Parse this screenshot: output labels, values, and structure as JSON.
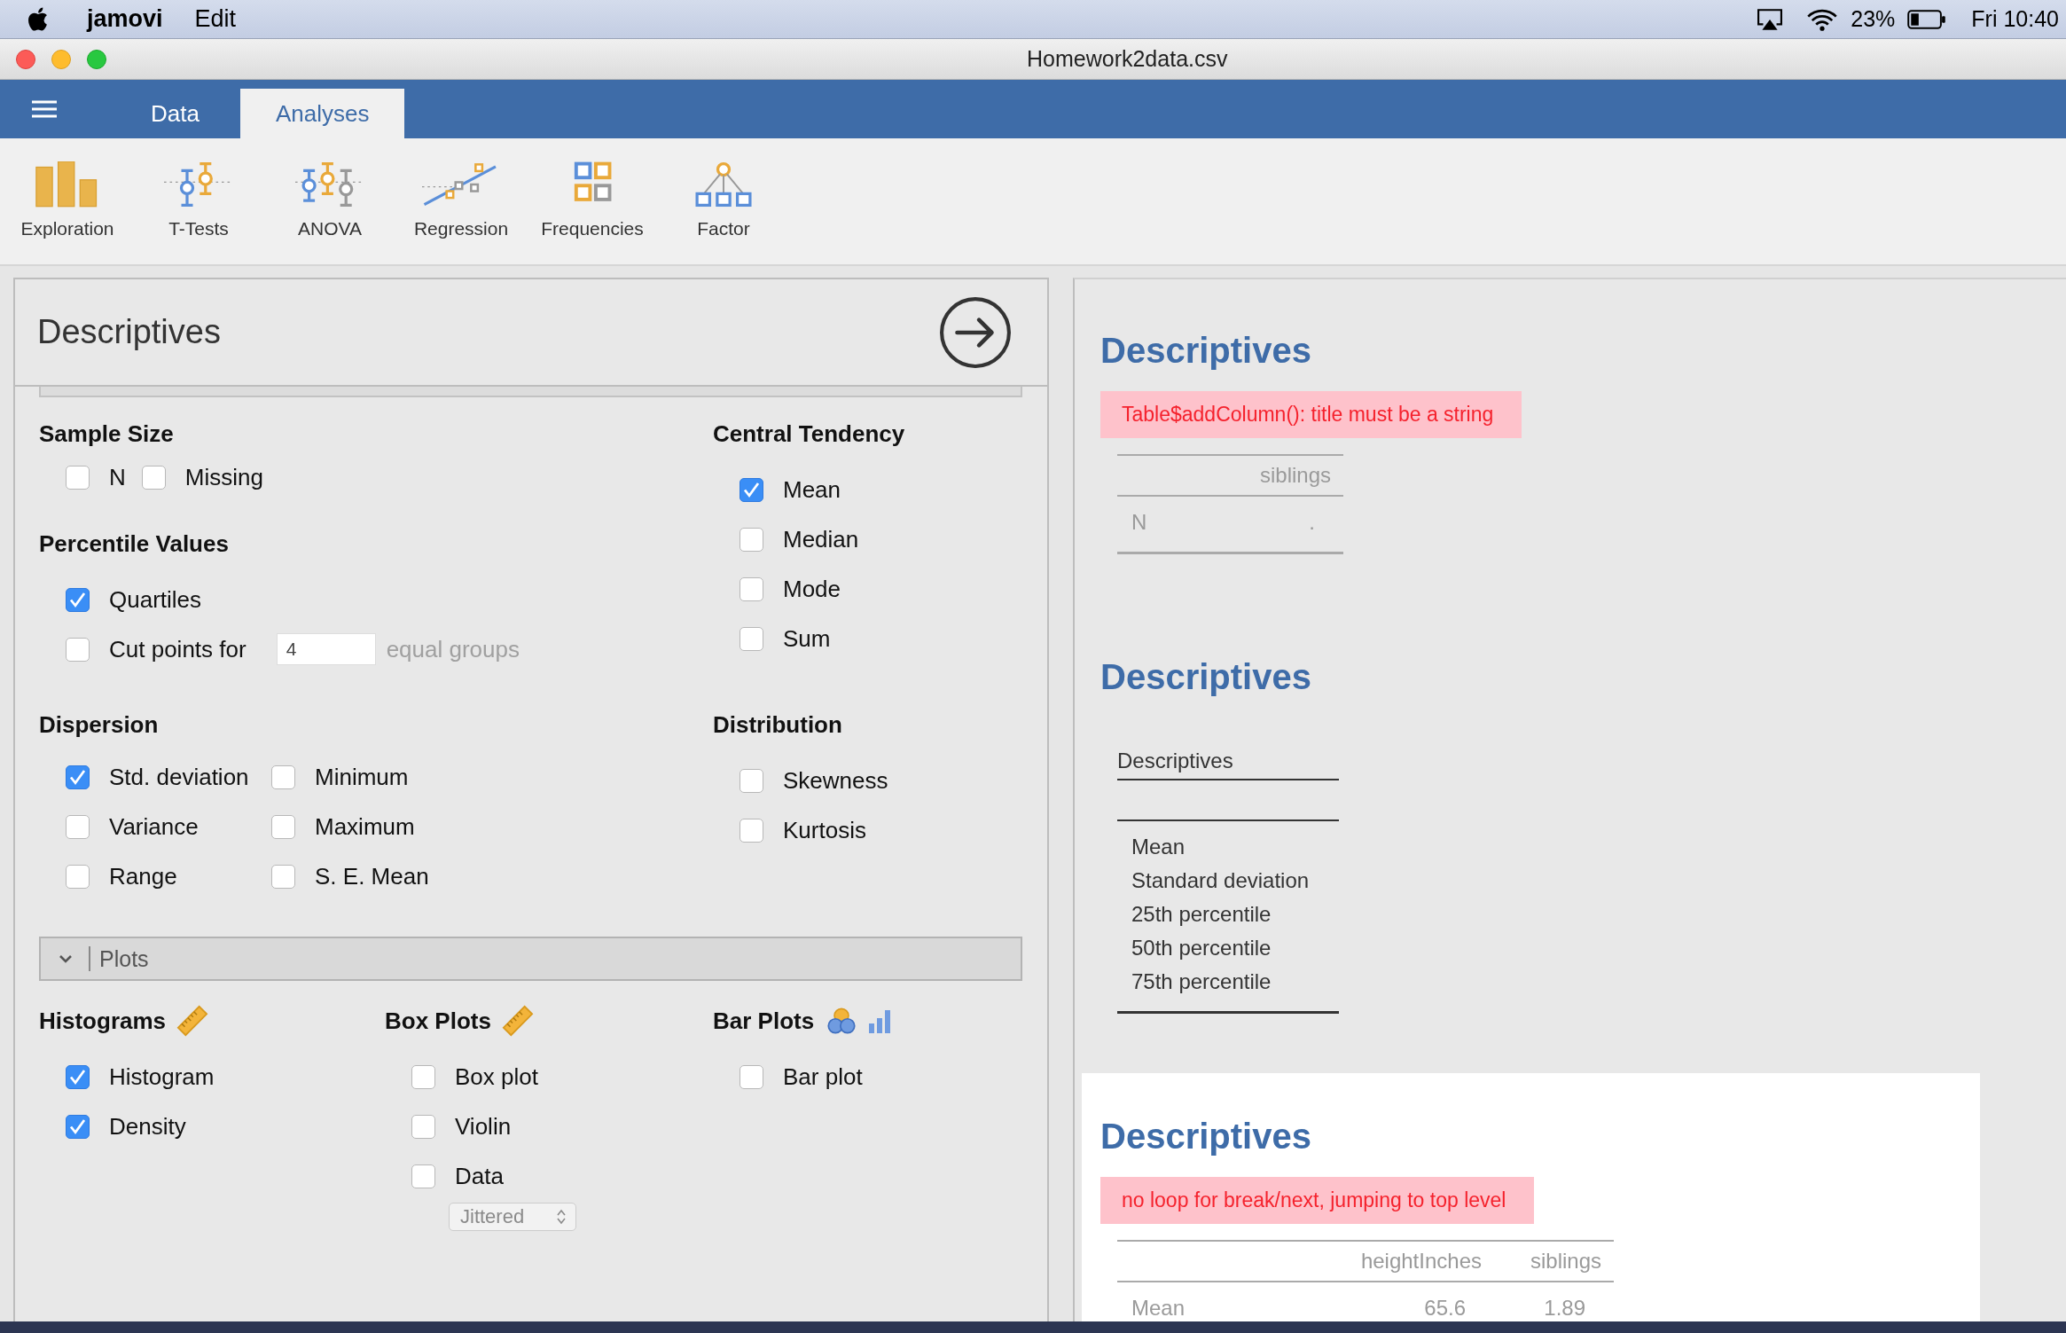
{
  "menubar": {
    "app": "jamovi",
    "menus": [
      "Edit"
    ],
    "battery": "23%",
    "clock": "Fri 10:40"
  },
  "window": {
    "title": "Homework2data.csv"
  },
  "tabs": [
    {
      "label": "Data",
      "selected": false
    },
    {
      "label": "Analyses",
      "selected": true
    }
  ],
  "ribbon": [
    {
      "label": "Exploration",
      "kind": "exploration"
    },
    {
      "label": "T-Tests",
      "kind": "ttests"
    },
    {
      "label": "ANOVA",
      "kind": "anova"
    },
    {
      "label": "Regression",
      "kind": "regression"
    },
    {
      "label": "Frequencies",
      "kind": "frequencies"
    },
    {
      "label": "Factor",
      "kind": "factor"
    }
  ],
  "options": {
    "title": "Descriptives",
    "rows": [
      {
        "left": [
          {
            "heading": "Sample Size",
            "kind": "inline",
            "items": [
              {
                "kind": "checkbox",
                "label": "N",
                "checked": false
              },
              {
                "kind": "checkbox",
                "label": "Missing",
                "checked": false
              }
            ]
          },
          {
            "heading": "Percentile Values",
            "kind": "list",
            "items": [
              {
                "kind": "checkbox",
                "label": "Quartiles",
                "checked": true
              },
              {
                "kind": "cutpoints",
                "label": "Cut points for",
                "checked": false,
                "value": "4",
                "suffix": "equal groups"
              }
            ]
          }
        ],
        "right": [
          {
            "heading": "Central Tendency",
            "kind": "list",
            "items": [
              {
                "kind": "checkbox",
                "label": "Mean",
                "checked": true
              },
              {
                "kind": "checkbox",
                "label": "Median",
                "checked": false
              },
              {
                "kind": "checkbox",
                "label": "Mode",
                "checked": false
              },
              {
                "kind": "checkbox",
                "label": "Sum",
                "checked": false
              }
            ]
          }
        ]
      },
      {
        "left": [
          {
            "heading": "Dispersion",
            "kind": "grid",
            "items": [
              {
                "kind": "checkbox",
                "label": "Std. deviation",
                "checked": true
              },
              {
                "kind": "checkbox",
                "label": "Variance",
                "checked": false
              },
              {
                "kind": "checkbox",
                "label": "Range",
                "checked": false
              },
              {
                "kind": "checkbox",
                "label": "Minimum",
                "checked": false
              },
              {
                "kind": "checkbox",
                "label": "Maximum",
                "checked": false
              },
              {
                "kind": "checkbox",
                "label": "S. E. Mean",
                "checked": false
              }
            ]
          }
        ],
        "right": [
          {
            "heading": "Distribution",
            "kind": "list",
            "items": [
              {
                "kind": "checkbox",
                "label": "Skewness",
                "checked": false
              },
              {
                "kind": "checkbox",
                "label": "Kurtosis",
                "checked": false
              }
            ]
          }
        ]
      }
    ],
    "plots": {
      "label": "Plots",
      "expanded": true,
      "columns": [
        {
          "heading": "Histograms",
          "kind": "histogram",
          "items": [
            {
              "label": "Histogram",
              "checked": true
            },
            {
              "label": "Density",
              "checked": true
            }
          ]
        },
        {
          "heading": "Box Plots",
          "kind": "boxplot",
          "items": [
            {
              "label": "Box plot",
              "checked": false
            },
            {
              "label": "Violin",
              "checked": false
            },
            {
              "label": "Data",
              "checked": false
            }
          ],
          "select": {
            "value": "Jittered",
            "disabled": true
          }
        },
        {
          "heading": "Bar Plots",
          "kind": "barplot",
          "items": [
            {
              "label": "Bar plot",
              "checked": false
            }
          ]
        }
      ]
    }
  },
  "results": [
    {
      "heading": "Descriptives",
      "selected": false,
      "error": "Table$addColumn(): title must be a string",
      "table": {
        "columns": [
          "siblings"
        ],
        "rows": [
          {
            "label": "N",
            "values": [
              "."
            ]
          }
        ]
      }
    },
    {
      "heading": "Descriptives",
      "selected": false,
      "table": {
        "title": "Descriptives",
        "rows": [
          {
            "label": "Mean"
          },
          {
            "label": "Standard deviation"
          },
          {
            "label": "25th percentile"
          },
          {
            "label": "50th percentile"
          },
          {
            "label": "75th percentile"
          }
        ]
      }
    },
    {
      "heading": "Descriptives",
      "selected": true,
      "error": "no loop for break/next, jumping to top level",
      "table": {
        "columns": [
          "heightInches",
          "siblings"
        ],
        "rows": [
          {
            "label": "Mean",
            "values": [
              "65.6",
              "1.89"
            ]
          }
        ]
      }
    }
  ]
}
